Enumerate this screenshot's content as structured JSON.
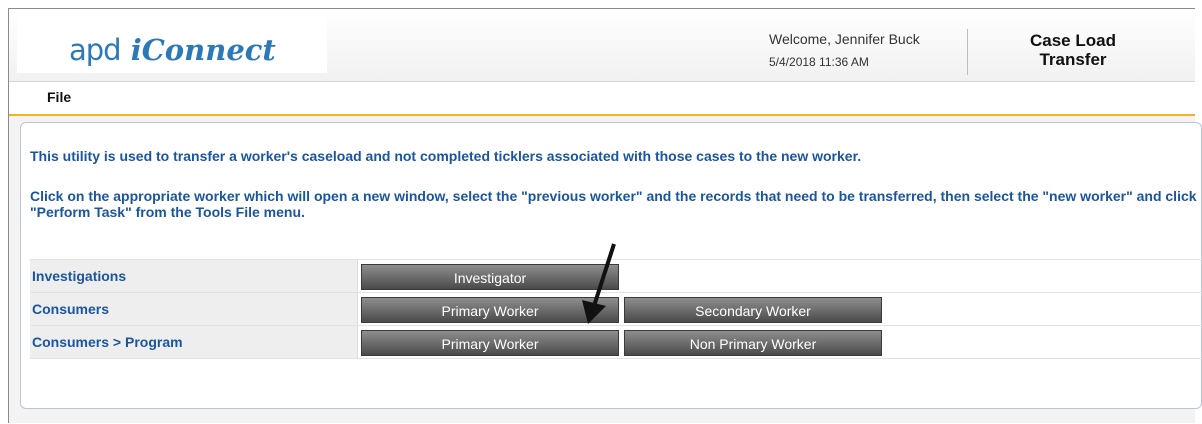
{
  "header": {
    "logo_prefix": "apd",
    "logo_suffix": "iConnect",
    "welcome": "Welcome, Jennifer Buck",
    "datetime": "5/4/2018 11:36 AM",
    "title_line1": "Case Load",
    "title_line2": "Transfer"
  },
  "menu": {
    "file": "File"
  },
  "content": {
    "info1": "This utility is used to transfer a worker's caseload and not completed ticklers associated with those cases to the new worker.",
    "info2": "Click on the appropriate worker which will open a new window, select the \"previous worker\" and the records that need to be transferred, then select the \"new worker\" and click \"Perform Task\" from the Tools File menu."
  },
  "rows": [
    {
      "label": "Investigations",
      "buttons": [
        "Investigator"
      ]
    },
    {
      "label": "Consumers",
      "buttons": [
        "Primary Worker",
        "Secondary Worker"
      ]
    },
    {
      "label": "Consumers > Program",
      "buttons": [
        "Primary Worker",
        "Non Primary Worker"
      ]
    }
  ],
  "colors": {
    "accent_blue": "#1a56a0",
    "menu_underline": "#f1b321",
    "button_dark": "#4a4a4a"
  }
}
